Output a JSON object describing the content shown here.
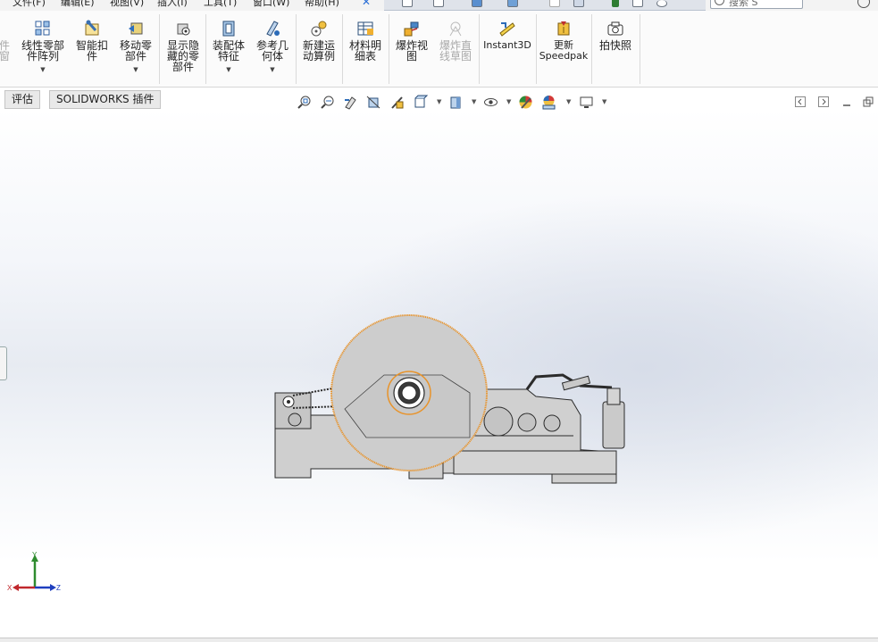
{
  "menubar": {
    "items": [
      "文件(F)",
      "编辑(E)",
      "视图(V)",
      "插入(I)",
      "工具(T)",
      "窗口(W)",
      "帮助(H)"
    ],
    "search_placeholder": "搜索 S"
  },
  "ribbon": {
    "buttons": [
      {
        "label": "件\n窗",
        "icon": "partial-cut-icon",
        "disabled": true
      },
      {
        "label": "线性零部\n件阵列",
        "icon": "linear-pattern-icon",
        "has_dropdown": true
      },
      {
        "label": "智能扣\n件",
        "icon": "smart-fastener-icon"
      },
      {
        "label": "移动零\n部件",
        "icon": "move-component-icon",
        "has_dropdown": true
      },
      {
        "label": "显示隐\n藏的零\n部件",
        "icon": "show-hidden-icon"
      },
      {
        "label": "装配体\n特征",
        "icon": "assembly-feature-icon",
        "has_dropdown": true
      },
      {
        "label": "参考几\n何体",
        "icon": "reference-geometry-icon",
        "has_dropdown": true
      },
      {
        "label": "新建运\n动算例",
        "icon": "motion-study-icon"
      },
      {
        "label": "材料明\n细表",
        "icon": "bom-icon"
      },
      {
        "label": "爆炸视\n图",
        "icon": "exploded-view-icon"
      },
      {
        "label": "爆炸直\n线草图",
        "icon": "explode-line-sketch-icon",
        "disabled": true
      },
      {
        "label": "Instant3D",
        "icon": "instant3d-icon"
      },
      {
        "label": "更新\nSpeedpak",
        "icon": "speedpak-icon"
      },
      {
        "label": "拍快照",
        "icon": "snapshot-icon"
      }
    ]
  },
  "tabs": [
    {
      "label": "评估"
    },
    {
      "label": "SOLIDWORKS 插件"
    }
  ],
  "triad": {
    "x_label": "X",
    "y_label": "Y",
    "z_label": "Z"
  },
  "colors": {
    "selection_orange": "#e8932a",
    "model_gray": "#c9c9c9",
    "model_outline": "#2b2b2b",
    "axis_x": "#c0282d",
    "axis_y": "#2e8b2e",
    "axis_z": "#1f3fbf"
  }
}
